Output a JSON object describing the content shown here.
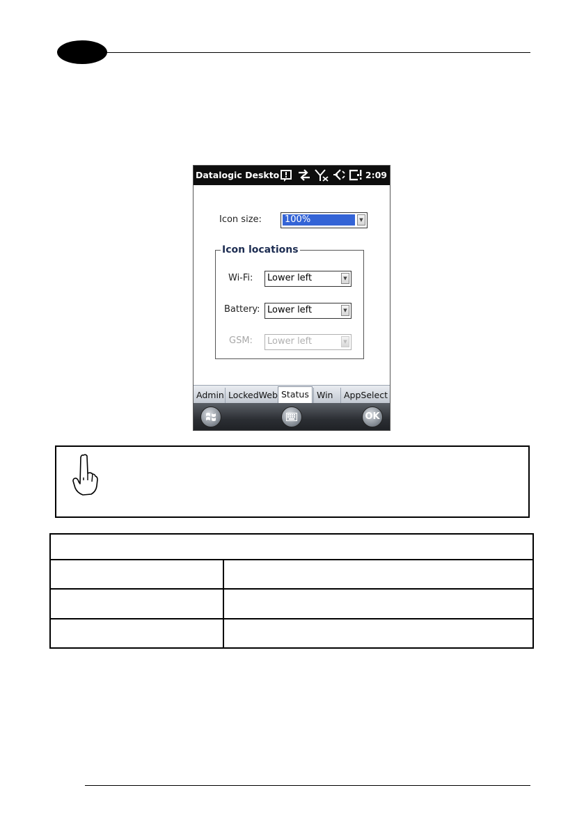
{
  "device": {
    "status_bar": {
      "title": "Datalogic Deskto",
      "time": "2:09",
      "icons": [
        "notification-icon",
        "sync-arrows-icon",
        "no-signal-icon",
        "speaker-muted-icon",
        "battery-charging-icon"
      ]
    },
    "icon_size": {
      "label": "Icon size:",
      "value": "100%"
    },
    "icon_locations": {
      "title": "Icon locations",
      "wifi": {
        "label": "Wi-Fi:",
        "value": "Lower left"
      },
      "battery": {
        "label": "Battery:",
        "value": "Lower left"
      },
      "gsm": {
        "label": "GSM:",
        "value": "Lower left",
        "disabled": true
      }
    },
    "tabs": [
      {
        "label": "Admin",
        "active": false
      },
      {
        "label": "LockedWeb",
        "active": false
      },
      {
        "label": "Status",
        "active": true
      },
      {
        "label": "Win",
        "active": false
      },
      {
        "label": "AppSelect",
        "active": false
      }
    ],
    "softkeys": {
      "start": "start-windows-icon",
      "keyboard": "keyboard-icon",
      "ok_label": "OK"
    }
  },
  "note": {
    "icon": "pointing-hand-icon"
  },
  "table": {
    "rows": 4,
    "columns": 2
  }
}
